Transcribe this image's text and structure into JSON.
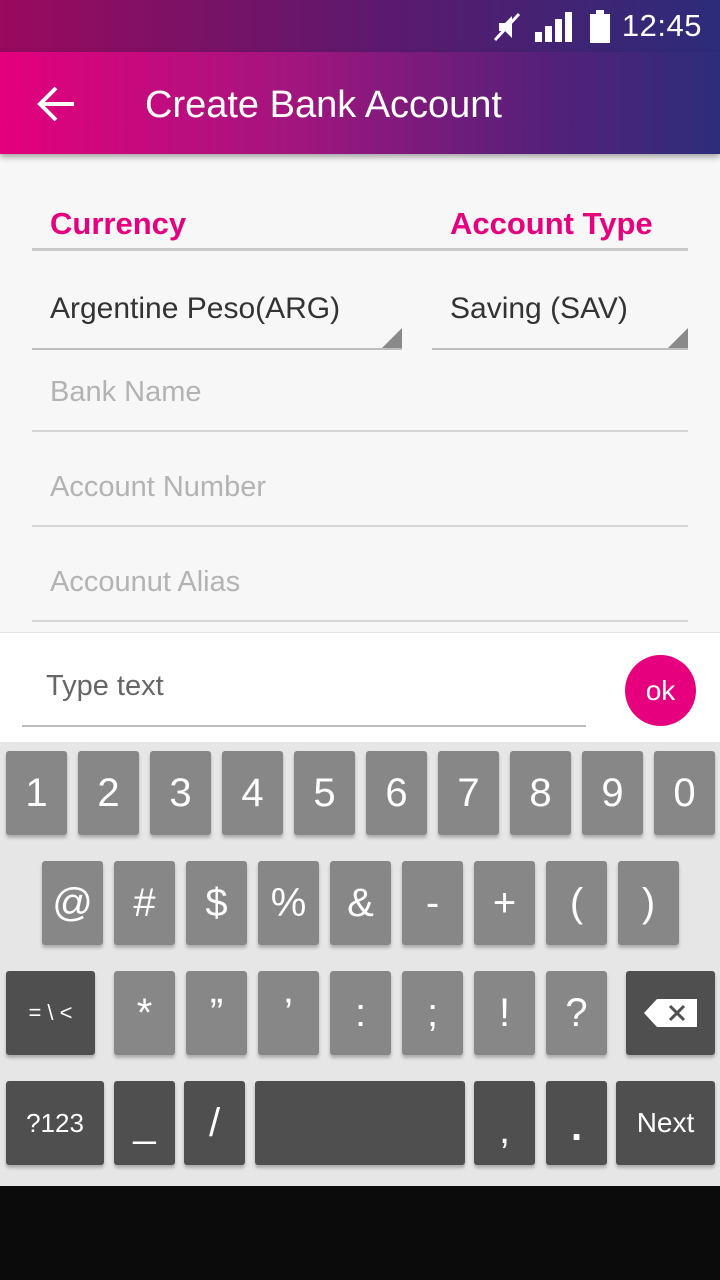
{
  "status_bar": {
    "time": "12:45",
    "icons": [
      "mute-icon",
      "signal-icon",
      "battery-icon"
    ]
  },
  "app_bar": {
    "title": "Create Bank Account",
    "back_icon": "arrow-left-icon"
  },
  "form": {
    "currency_label": "Currency",
    "account_type_label": "Account Type",
    "currency_value": "Argentine Peso(ARG)",
    "account_type_value": "Saving (SAV)",
    "bank_name_placeholder": "Bank Name",
    "account_number_placeholder": "Account Number",
    "account_alias_placeholder": "Accounut Alias"
  },
  "input_bar": {
    "placeholder": "Type text",
    "ok_label": "ok"
  },
  "keyboard": {
    "row1": [
      "1",
      "2",
      "3",
      "4",
      "5",
      "6",
      "7",
      "8",
      "9",
      "0"
    ],
    "row2": [
      "@",
      "#",
      "$",
      "%",
      "&",
      "-",
      "+",
      "(",
      ")"
    ],
    "row3": [
      "= \\ <",
      "*",
      "”",
      "’",
      ":",
      ";",
      "!",
      "?"
    ],
    "row4": [
      "?123",
      "_",
      "/",
      "",
      ",",
      ".",
      "Next"
    ]
  },
  "colors": {
    "accent": "#e6007e",
    "gradient_start": "#e5007d",
    "gradient_end": "#2d2d7b",
    "key": "#878787",
    "key_dark": "#4f4f4f"
  }
}
